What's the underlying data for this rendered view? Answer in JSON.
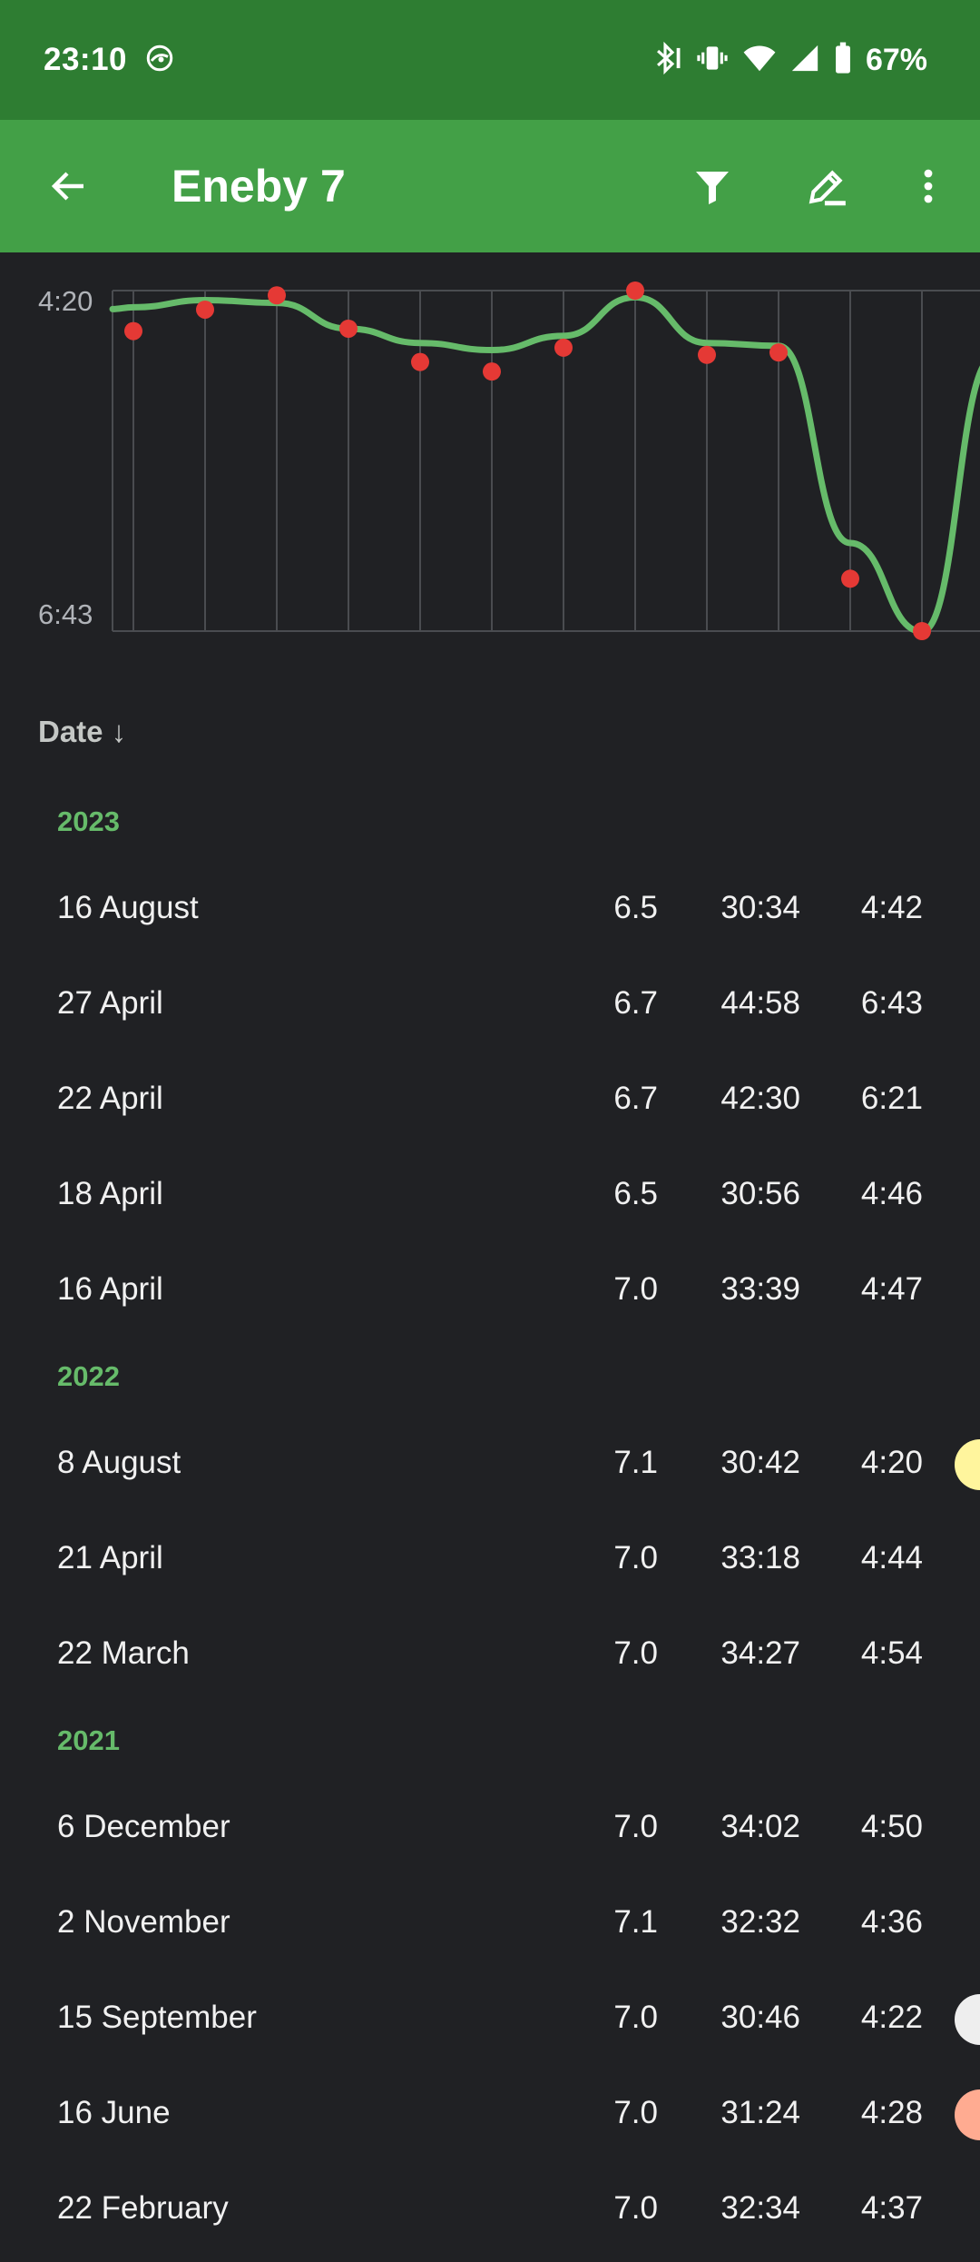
{
  "status_bar": {
    "time": "23:10",
    "battery": "67%",
    "icons": [
      "hotspot-icon",
      "bluetooth-icon",
      "vibrate-icon",
      "wifi-icon",
      "signal-icon",
      "battery-icon"
    ]
  },
  "app_bar": {
    "title": "Eneby 7",
    "icons": [
      "back-arrow-icon",
      "filter-icon",
      "edit-icon",
      "more-vert-icon"
    ]
  },
  "chart_data": {
    "type": "scatter",
    "y_axis_labels": [
      "4:20",
      "6:43"
    ],
    "ylim": [
      "6:43",
      "4:20"
    ],
    "y_inverted": true,
    "grid": true,
    "colors": {
      "line": "#66bb6a",
      "points": "#e53935",
      "grid": "#4a4c50"
    },
    "points": [
      {
        "date": "22 February 2021",
        "pace": "4:37"
      },
      {
        "date": "16 June 2021",
        "pace": "4:28"
      },
      {
        "date": "15 September 2021",
        "pace": "4:22"
      },
      {
        "date": "2 November 2021",
        "pace": "4:36"
      },
      {
        "date": "6 December 2021",
        "pace": "4:50"
      },
      {
        "date": "22 March 2022",
        "pace": "4:54"
      },
      {
        "date": "21 April 2022",
        "pace": "4:44"
      },
      {
        "date": "8 August 2022",
        "pace": "4:20"
      },
      {
        "date": "16 April 2023",
        "pace": "4:47"
      },
      {
        "date": "18 April 2023",
        "pace": "4:46"
      },
      {
        "date": "22 April 2023",
        "pace": "6:21"
      },
      {
        "date": "27 April 2023",
        "pace": "6:43"
      },
      {
        "date": "16 August 2023",
        "pace": "4:42"
      }
    ],
    "trend_line": [
      4.45,
      4.4,
      4.42,
      4.6,
      4.7,
      4.75,
      4.65,
      4.38,
      4.7,
      4.72,
      6.1,
      6.72,
      4.8
    ]
  },
  "list": {
    "sort_label": "Date ↓",
    "groups": [
      {
        "year": "2023",
        "rows": [
          {
            "date": "16 August",
            "score": "6.5",
            "time": "30:34",
            "pace": "4:42",
            "marker": null
          },
          {
            "date": "27 April",
            "score": "6.7",
            "time": "44:58",
            "pace": "6:43",
            "marker": null
          },
          {
            "date": "22 April",
            "score": "6.7",
            "time": "42:30",
            "pace": "6:21",
            "marker": null
          },
          {
            "date": "18 April",
            "score": "6.5",
            "time": "30:56",
            "pace": "4:46",
            "marker": null
          },
          {
            "date": "16 April",
            "score": "7.0",
            "time": "33:39",
            "pace": "4:47",
            "marker": null
          }
        ]
      },
      {
        "year": "2022",
        "rows": [
          {
            "date": "8 August",
            "score": "7.1",
            "time": "30:42",
            "pace": "4:20",
            "marker": "#fff59d"
          },
          {
            "date": "21 April",
            "score": "7.0",
            "time": "33:18",
            "pace": "4:44",
            "marker": null
          },
          {
            "date": "22 March",
            "score": "7.0",
            "time": "34:27",
            "pace": "4:54",
            "marker": null
          }
        ]
      },
      {
        "year": "2021",
        "rows": [
          {
            "date": "6 December",
            "score": "7.0",
            "time": "34:02",
            "pace": "4:50",
            "marker": null
          },
          {
            "date": "2 November",
            "score": "7.1",
            "time": "32:32",
            "pace": "4:36",
            "marker": null
          },
          {
            "date": "15 September",
            "score": "7.0",
            "time": "30:46",
            "pace": "4:22",
            "marker": "#eeeeee"
          },
          {
            "date": "16 June",
            "score": "7.0",
            "time": "31:24",
            "pace": "4:28",
            "marker": "#ffab91"
          },
          {
            "date": "22 February",
            "score": "7.0",
            "time": "32:34",
            "pace": "4:37",
            "marker": null
          }
        ]
      }
    ]
  }
}
